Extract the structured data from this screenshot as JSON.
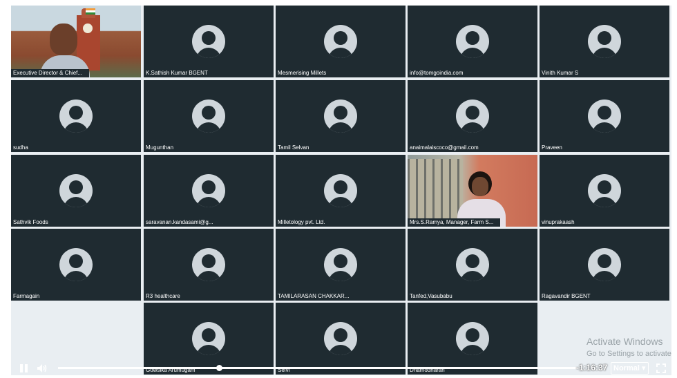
{
  "participants": [
    {
      "name": "Executive Director & Chief...",
      "video": "camera-1"
    },
    {
      "name": "K.Sathish Kumar BGENT"
    },
    {
      "name": "Mesmerising Millets"
    },
    {
      "name": "info@tomgoindia.com"
    },
    {
      "name": "Vinith Kumar S"
    },
    {
      "name": "sudha"
    },
    {
      "name": "Mugunthan"
    },
    {
      "name": "Tamil Selvan"
    },
    {
      "name": "anaimalaiscoco@gmail.com"
    },
    {
      "name": "Praveen"
    },
    {
      "name": "Sathvik Foods"
    },
    {
      "name": "saravanan.kandasami@g..."
    },
    {
      "name": "Milletology pvt. Ltd."
    },
    {
      "name": "Mrs.S.Ramya, Manager, Farm S...",
      "video": "camera-2"
    },
    {
      "name": "vinuprakaash"
    },
    {
      "name": "Farmagain"
    },
    {
      "name": "R3 healthcare"
    },
    {
      "name": "TAMILARASAN CHAKKAR..."
    },
    {
      "name": "Tanfed,Vasubabu"
    },
    {
      "name": "Ragavandir BGENT"
    },
    {
      "name": "Gowsika Arumugam"
    },
    {
      "name": "Selvi"
    },
    {
      "name": "Dhamodharan"
    }
  ],
  "watermark": {
    "title": "Activate Windows",
    "subtitle": "Go to Settings to activate"
  },
  "player": {
    "time_remaining": "-1:16:37",
    "quality": "Normal",
    "progress": 0.31,
    "icons": [
      "pause-icon",
      "volume-icon",
      "chevron-down-icon",
      "fullscreen-icon"
    ]
  }
}
